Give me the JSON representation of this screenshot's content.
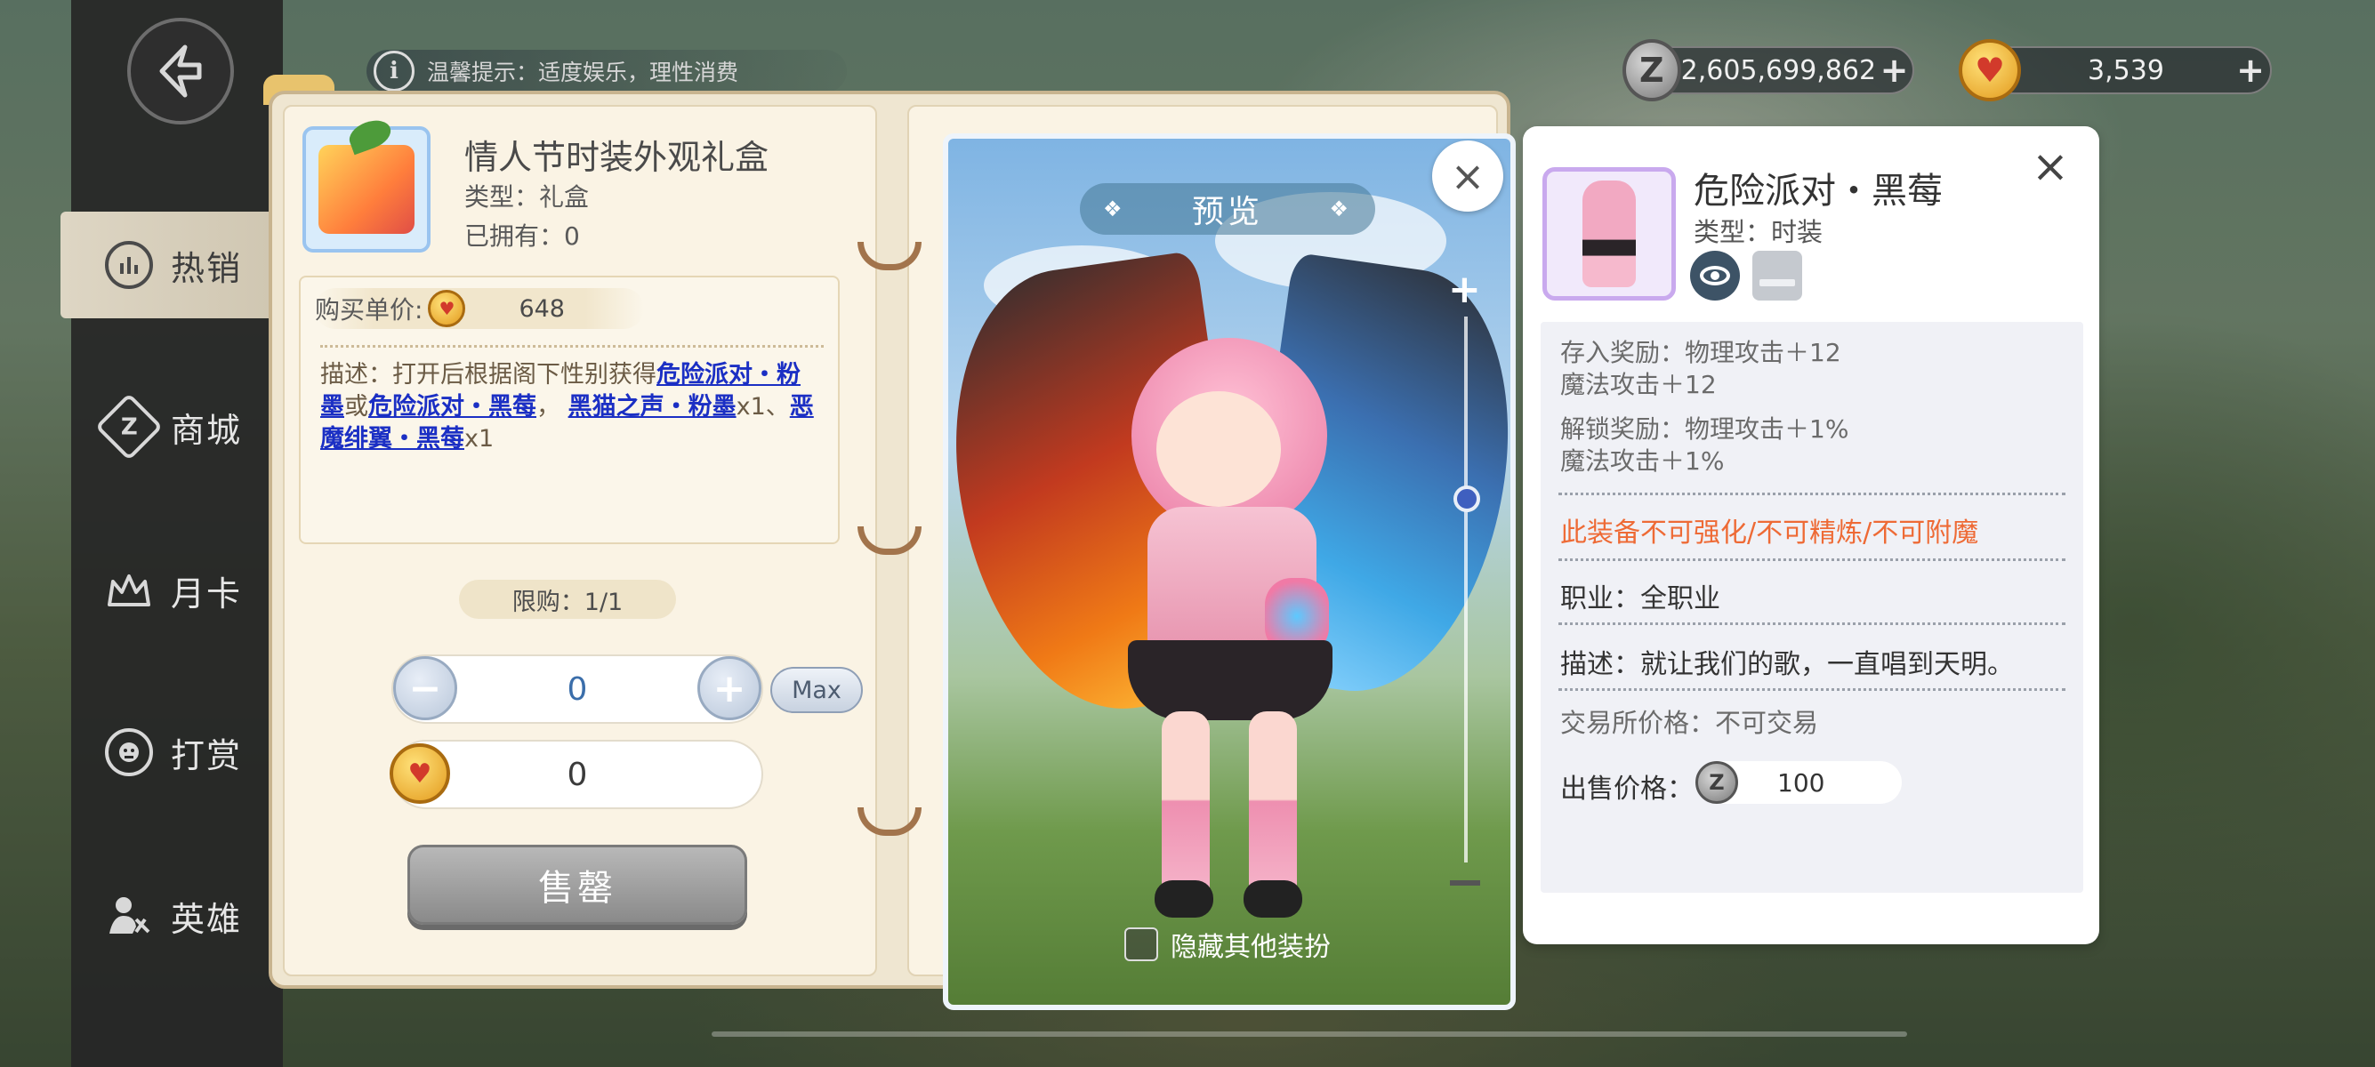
{
  "top_bar": {
    "tip_text": "温馨提示：适度娱乐，理性消费",
    "zeny_amount": "2,605,699,862",
    "gem_amount": "3,539",
    "plus": "+"
  },
  "sidebar": {
    "items": [
      {
        "label": "热销",
        "icon": "chart-icon"
      },
      {
        "label": "商城",
        "icon": "zeny-icon"
      },
      {
        "label": "月卡",
        "icon": "crown-icon"
      },
      {
        "label": "打赏",
        "icon": "face-icon"
      },
      {
        "label": "英雄",
        "icon": "hero-icon"
      }
    ]
  },
  "item": {
    "title": "情人节时装外观礼盒",
    "type": "类型：礼盒",
    "owned": "已拥有：0",
    "price_label": "购买单价:",
    "price_value": "648",
    "desc_prefix": "描述：打开后根据阁下性别获得",
    "link1": "危险派对・粉墨",
    "or": "或",
    "link2": "危险派对・黑莓",
    "comma": "，",
    "link3": "黑猫之声・粉墨",
    "x1a": "x1、",
    "link4": "恶魔绯翼・黑莓",
    "x1b": "x1",
    "limit": "限购：1/1",
    "quantity": "0",
    "max_label": "Max",
    "total": "0",
    "sell_label": "售罄"
  },
  "preview": {
    "title": "预览",
    "hide_label": "隐藏其他装扮",
    "close": "×",
    "zoom_plus": "+"
  },
  "detail": {
    "title": "危险派对・黑莓",
    "type": "类型：时装",
    "close": "×",
    "store_reward_1": "存入奖励：物理攻击＋12",
    "store_reward_2": "魔法攻击＋12",
    "unlock_reward_1": "解锁奖励：物理攻击＋1%",
    "unlock_reward_2": "魔法攻击＋1%",
    "warning": "此装备不可强化/不可精炼/不可附魔",
    "job": "职业：全职业",
    "description": "描述：就让我们的歌，一直唱到天明。",
    "trade": "交易所价格：不可交易",
    "sell_label": "出售价格：",
    "sell_value": "100"
  },
  "colors": {
    "accent_link": "#1b2fc4",
    "warning": "#ee6a35",
    "active_tab": "#ded6c4"
  }
}
